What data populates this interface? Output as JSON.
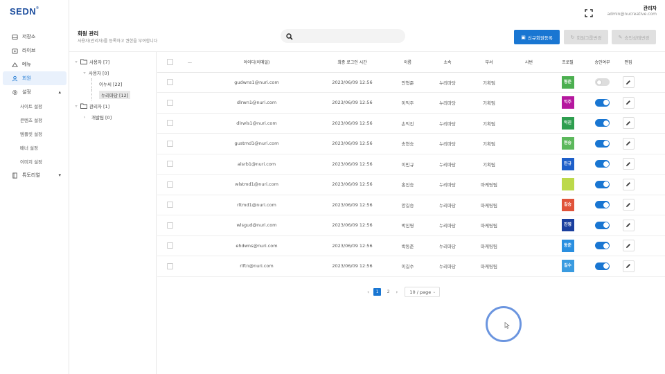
{
  "brand": {
    "logo": "SEDN",
    "mark": "®"
  },
  "header": {
    "user_name": "관리자",
    "user_email": "admin@nucreative.com"
  },
  "sidebar": {
    "items": [
      {
        "label": "저장소",
        "icon": "storage-icon"
      },
      {
        "label": "라이브",
        "icon": "live-icon"
      },
      {
        "label": "메뉴",
        "icon": "menu-icon"
      },
      {
        "label": "회원",
        "icon": "user-icon",
        "active": true
      },
      {
        "label": "설정",
        "icon": "gear-icon",
        "expanded": true
      },
      {
        "label": "튜토리얼",
        "icon": "book-icon"
      }
    ],
    "settings_children": [
      "사이트 설정",
      "콘텐츠 설정",
      "템플릿 설정",
      "배너 설정",
      "이미지 설정"
    ]
  },
  "page": {
    "title": "회원 관리",
    "description": "사용자(관리자)를 등록하고 권한을 부여합니다",
    "search_placeholder": "",
    "buttons": {
      "new_member": "신규회원등록",
      "group_change": "회원그룹변경",
      "approve_change": "승인상태변경"
    }
  },
  "tree": {
    "user_root": "사용자 [7]",
    "user_child": "사용자 [0]",
    "user_g1": "이누씨 [22]",
    "user_g2": "누리마당 [12]",
    "admin_root": "관리자 [1]",
    "admin_child": "개발팀 [0]"
  },
  "table": {
    "columns": {
      "dots": "...",
      "id": "아이디(이메일)",
      "last_login": "최종 로그인 시간",
      "name": "이름",
      "org": "소속",
      "dept": "부서",
      "photo": "사번",
      "profile": "프로필",
      "approved": "승인여부",
      "edit": "편집"
    },
    "rows": [
      {
        "id": "gudwns1@nuri.com",
        "login": "2023/06/09 12:56",
        "name": "안형준",
        "org": "누리마당",
        "dept": "기획팀",
        "avatar": "형준",
        "avatar_color": "#4caf50",
        "on": false
      },
      {
        "id": "dlrwn1@nuri.com",
        "login": "2023/06/09 12:56",
        "name": "이익주",
        "org": "누리마당",
        "dept": "기획팀",
        "avatar": "익주",
        "avatar_color": "#b5179e",
        "on": true
      },
      {
        "id": "dlrwls1@nuri.com",
        "login": "2023/06/09 12:56",
        "name": "손익진",
        "org": "누리마당",
        "dept": "기획팀",
        "avatar": "익진",
        "avatar_color": "#2e9e4f",
        "on": true
      },
      {
        "id": "gustmd1@nuri.com",
        "login": "2023/06/09 12:56",
        "name": "송현승",
        "org": "누리마당",
        "dept": "기획팀",
        "avatar": "현승",
        "avatar_color": "#5cb85c",
        "on": true
      },
      {
        "id": "alsrb1@nuri.com",
        "login": "2023/06/09 12:56",
        "name": "이민규",
        "org": "누리마당",
        "dept": "기획팀",
        "avatar": "민규",
        "avatar_color": "#1e5fc9",
        "on": true
      },
      {
        "id": "wlstmd1@nuri.com",
        "login": "2023/06/09 12:56",
        "name": "홍진승",
        "org": "누리마당",
        "dept": "마케팅팀",
        "avatar": "",
        "avatar_color": "#bcd94a",
        "on": true
      },
      {
        "id": "rltmd1@nuri.com",
        "login": "2023/06/09 12:56",
        "name": "양길승",
        "org": "누리마당",
        "dept": "마케팅팀",
        "avatar": "길승",
        "avatar_color": "#e0533a",
        "on": true
      },
      {
        "id": "wlsgud@nuri.com",
        "login": "2023/06/09 12:56",
        "name": "박진영",
        "org": "누리마당",
        "dept": "마케팅팀",
        "avatar": "진영",
        "avatar_color": "#1a3f9e",
        "on": true
      },
      {
        "id": "ehdwns@nuri.com",
        "login": "2023/06/09 12:56",
        "name": "박동준",
        "org": "누리마당",
        "dept": "마케팅팀",
        "avatar": "동준",
        "avatar_color": "#2a8fe0",
        "on": true
      },
      {
        "id": "rlftn@nuri.com",
        "login": "2023/06/09 12:56",
        "name": "이길수",
        "org": "누리마당",
        "dept": "마케팅팀",
        "avatar": "길수",
        "avatar_color": "#3a9be0",
        "on": true
      }
    ]
  },
  "pagination": {
    "pages": [
      "1",
      "2"
    ],
    "current": "1",
    "page_size": "10 / page"
  }
}
